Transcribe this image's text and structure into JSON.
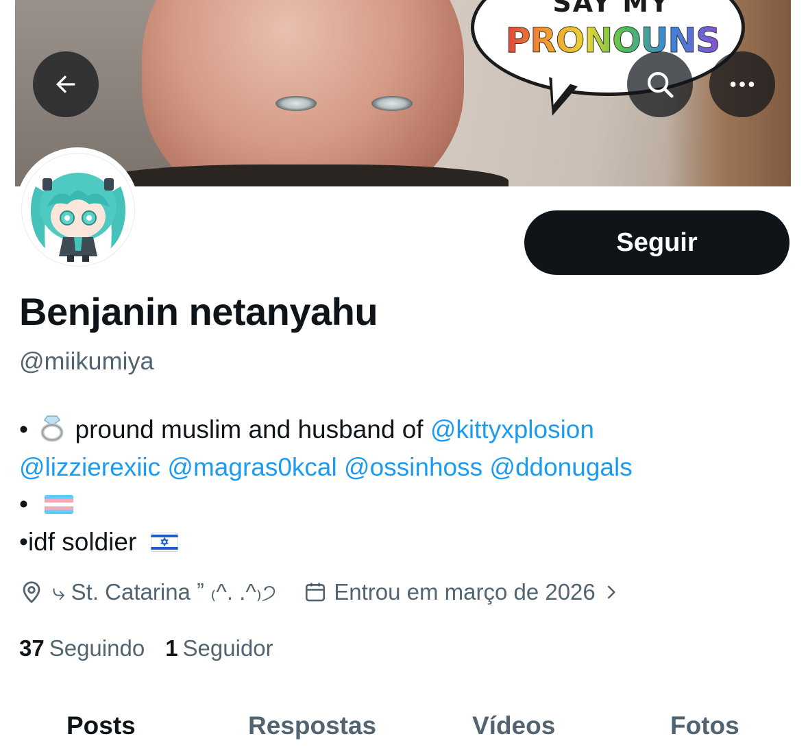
{
  "banner": {
    "speech_bubble_top": "SAY MY",
    "speech_bubble_text": "PRONOUNS"
  },
  "header_buttons": {
    "back_icon": "arrow-left-icon",
    "search_icon": "search-icon",
    "more_icon": "more-horizontal-icon"
  },
  "profile": {
    "follow_label": "Seguir",
    "display_name": "Benjanin netanyahu",
    "handle": "@miikumiya",
    "bio": {
      "line1_prefix": "•",
      "line1_text": "pround muslim and husband of",
      "line1_mention": "@kittyxplosion",
      "line2_mentions": [
        "@lizzierexiic",
        "@magras0kcal",
        "@ossinhoss",
        "@ddonugals"
      ],
      "line3_prefix": "•",
      "line4_text": "•idf soldier"
    },
    "location": "⤷ St. Catarina ˮ ₍^. .^₎੭",
    "joined": "Entrou em março de 2026",
    "following_count": "37",
    "following_label": "Seguindo",
    "followers_count": "1",
    "followers_label": "Seguidor"
  },
  "tabs": [
    {
      "label": "Posts",
      "active": true
    },
    {
      "label": "Respostas",
      "active": false
    },
    {
      "label": "Vídeos",
      "active": false
    },
    {
      "label": "Fotos",
      "active": false
    }
  ],
  "colors": {
    "text_primary": "#0f1419",
    "text_secondary": "#536471",
    "link": "#1d9bf0",
    "button_bg": "#0f1419"
  }
}
